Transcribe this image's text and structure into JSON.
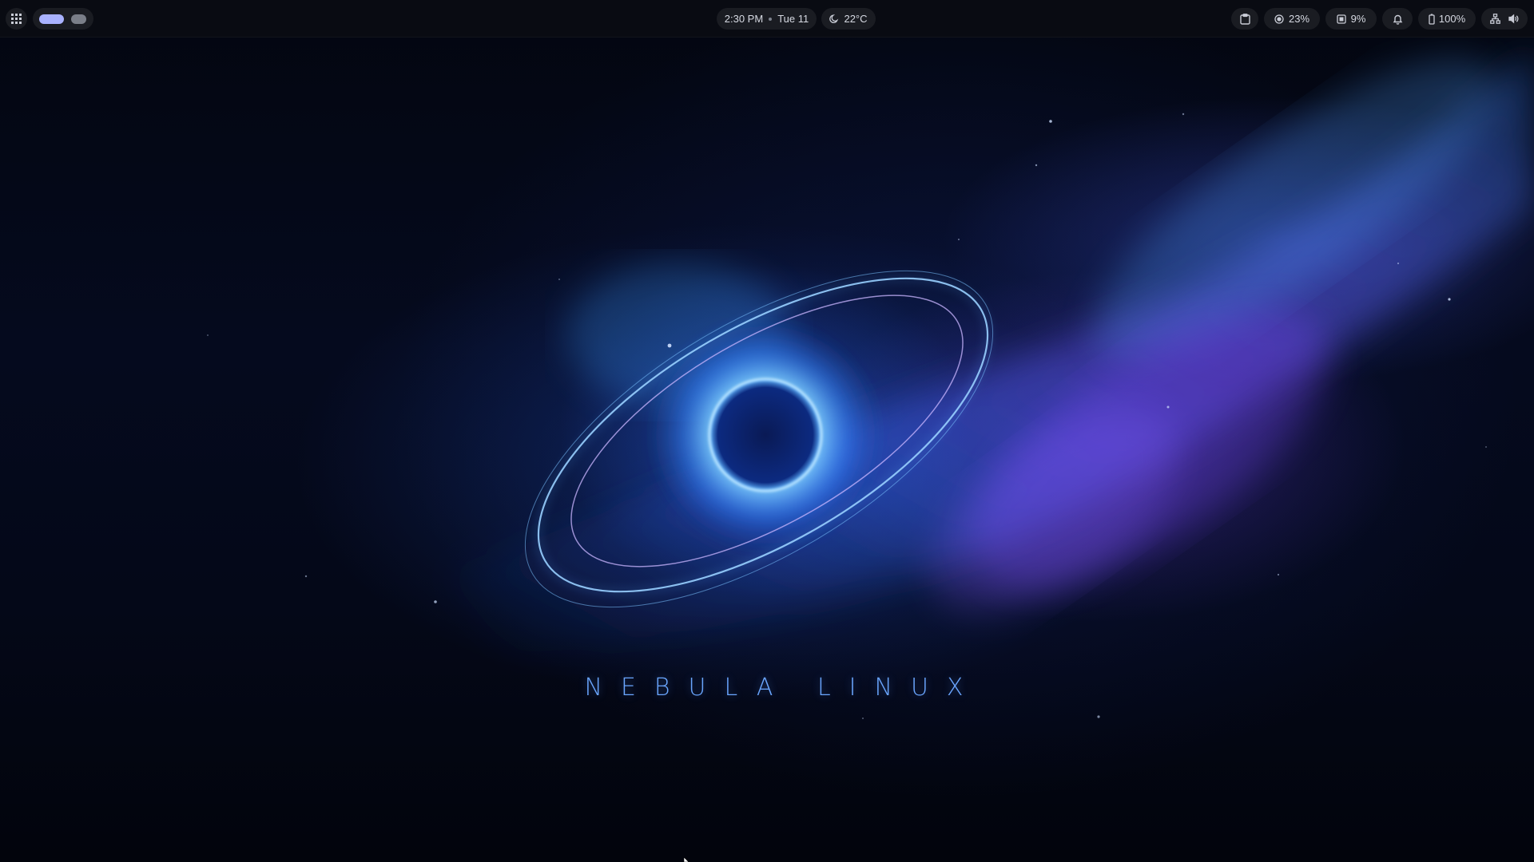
{
  "topbar": {
    "left": {
      "apps_icon": "grid-icon",
      "workspaces": [
        {
          "id": 1,
          "active": true
        },
        {
          "id": 2,
          "active": false
        }
      ]
    },
    "center": {
      "time": "2:30 PM",
      "date": "Tue 11",
      "weather_icon": "moon-icon",
      "temperature": "22°C"
    },
    "right": {
      "clipboard_icon": "clipboard-icon",
      "cpu_icon": "cpu-icon",
      "cpu_usage": "23%",
      "ram_icon": "memory-icon",
      "ram_usage": "9%",
      "notification_icon": "bell-icon",
      "battery_icon": "battery-icon",
      "battery": "100%",
      "network_icon": "network-icon",
      "volume_icon": "volume-icon"
    }
  },
  "wallpaper": {
    "brand_text": "NEBULA LINUX",
    "colors": {
      "accent": "#a9b2ff",
      "brand": "#6aa6ff",
      "nebula_blue": "#3a7bff",
      "nebula_violet": "#7b4dff"
    }
  }
}
